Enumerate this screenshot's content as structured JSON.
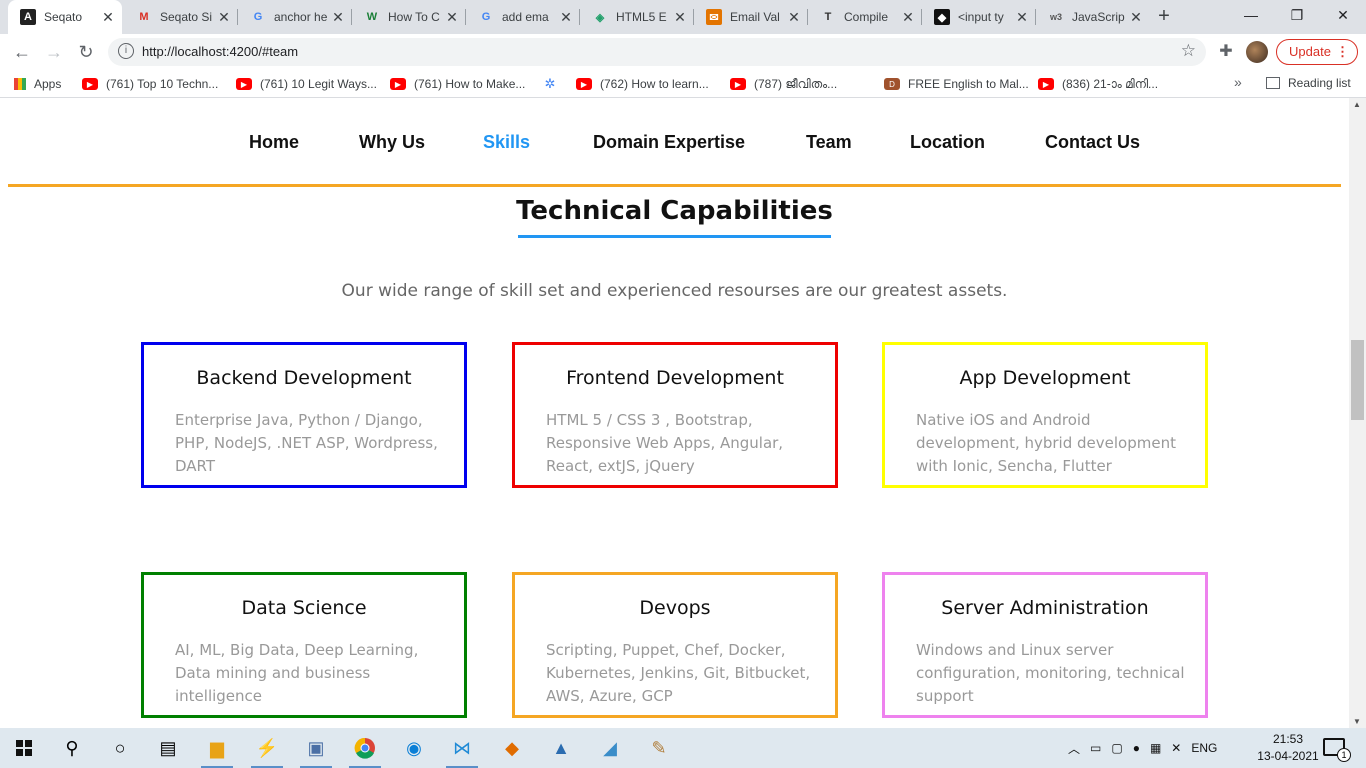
{
  "browser": {
    "tabs": [
      {
        "title": "Seqato",
        "active": true,
        "icon": "angular-icon"
      },
      {
        "title": "Seqato Si",
        "icon": "gmail-icon"
      },
      {
        "title": "anchor he",
        "icon": "google-icon"
      },
      {
        "title": "How To C",
        "icon": "wikihow-icon"
      },
      {
        "title": "add ema",
        "icon": "google-icon"
      },
      {
        "title": "HTML5 E",
        "icon": "html-icon"
      },
      {
        "title": "Email Val",
        "icon": "site-icon"
      },
      {
        "title": "Compile",
        "icon": "typewriter-icon"
      },
      {
        "title": "<input ty",
        "icon": "github-icon"
      },
      {
        "title": "JavaScrip",
        "icon": "w3schools-icon"
      }
    ],
    "new_tab": "+",
    "url": "http://localhost:4200/#team",
    "update_label": "Update",
    "bookmarks": [
      {
        "label": "Apps"
      },
      {
        "label": "(761) Top 10 Techn..."
      },
      {
        "label": "(761) 10 Legit Ways..."
      },
      {
        "label": "(761) How to Make..."
      },
      {
        "label": ""
      },
      {
        "label": "(762) How to learn..."
      },
      {
        "label": "(787) ജീവിതം..."
      },
      {
        "label": "FREE English to Mal..."
      },
      {
        "label": "(836) 21-ാം മിനി..."
      }
    ],
    "more_bookmarks": "»",
    "reading_list": "Reading list"
  },
  "page": {
    "nav": [
      "Home",
      "Why Us",
      "Skills",
      "Domain Expertise",
      "Team",
      "Location",
      "Contact Us"
    ],
    "active_nav": "Skills",
    "title": "Technical Capabilities",
    "subtitle": "Our wide range of skill set and experienced resourses are our greatest assets.",
    "cards": [
      {
        "title": "Backend Development",
        "text": "Enterprise Java, Python / Django, PHP, NodeJS, .NET ASP, Wordpress, DART",
        "color": "#0000ee"
      },
      {
        "title": "Frontend Development",
        "text": "HTML 5 / CSS 3 , Bootstrap, Responsive Web Apps, Angular, React, extJS, jQuery",
        "color": "#ee0000"
      },
      {
        "title": "App Development",
        "text": "Native iOS and Android development, hybrid development with Ionic, Sencha, Flutter",
        "color": "#ffff00"
      },
      {
        "title": "Data Science",
        "text": "AI, ML, Big Data, Deep Learning, Data mining and business intelligence",
        "color": "#008000"
      },
      {
        "title": "Devops",
        "text": "Scripting, Puppet, Chef, Docker, Kubernetes, Jenkins, Git, Bitbucket, AWS, Azure, GCP",
        "color": "#f5a623"
      },
      {
        "title": "Server Administration",
        "text": "Windows and Linux server configuration, monitoring, technical support",
        "color": "#ee82ee"
      }
    ]
  },
  "taskbar": {
    "language": "ENG",
    "time": "21:53",
    "date": "13-04-2021",
    "notifications": "1"
  }
}
